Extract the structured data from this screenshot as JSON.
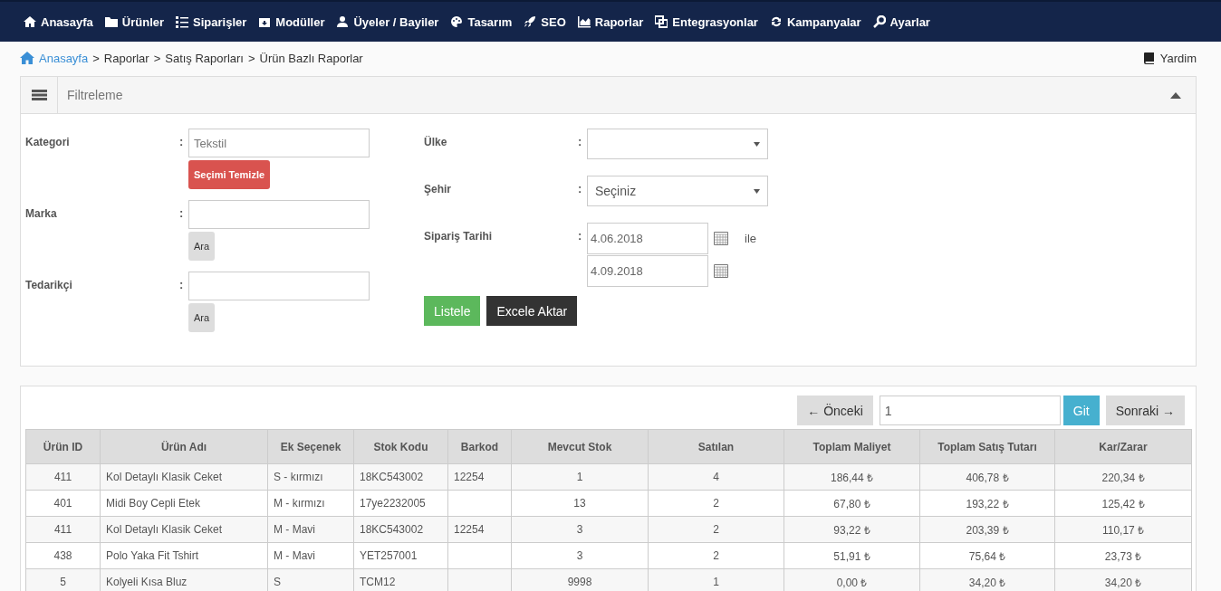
{
  "nav": [
    {
      "label": "Anasayfa"
    },
    {
      "label": "Ürünler"
    },
    {
      "label": "Siparişler"
    },
    {
      "label": "Modüller"
    },
    {
      "label": "Üyeler / Bayiler"
    },
    {
      "label": "Tasarım"
    },
    {
      "label": "SEO"
    },
    {
      "label": "Raporlar"
    },
    {
      "label": "Entegrasyonlar"
    },
    {
      "label": "Kampanyalar"
    },
    {
      "label": "Ayarlar"
    }
  ],
  "breadcrumb": {
    "home": "Anasayfa",
    "items": [
      {
        "separator": ">",
        "label": "Raporlar"
      },
      {
        "separator": ">",
        "label": "Satış Raporları"
      },
      {
        "separator": ">",
        "label": "Ürün Bazlı Raporlar"
      }
    ],
    "help": "Yardim"
  },
  "filter": {
    "title": "Filtreleme",
    "expanded": true,
    "left": [
      {
        "label": "Kategori",
        "colon": ":",
        "kind": "text",
        "value": "Tekstil",
        "button": {
          "label": "Seçimi Temizle",
          "kind": "danger"
        }
      },
      {
        "label": "Marka",
        "colon": ":",
        "kind": "text",
        "button": {
          "label": "Ara",
          "kind": "default"
        }
      },
      {
        "label": "Tedarikçi",
        "colon": ":",
        "kind": "text",
        "button": {
          "label": "Ara",
          "kind": "default"
        }
      }
    ],
    "right": [
      {
        "label": "Ülke",
        "colon": ":",
        "kind": "select"
      },
      {
        "label": "Şehir",
        "colon": ":",
        "kind": "select",
        "value": "Seçiniz"
      },
      {
        "label": "Sipariş Tarihi",
        "colon": ":",
        "kind": "daterange",
        "from": "4.06.2018",
        "between": "ile",
        "to": "4.09.2018"
      }
    ],
    "actions": [
      {
        "label": "Listele",
        "kind": "success"
      },
      {
        "label": "Excele Aktar",
        "kind": "dark"
      }
    ]
  },
  "pager": {
    "previous": "← Önceki",
    "page": "1",
    "go": "Git",
    "next": "Sonraki →"
  },
  "table": {
    "columns": [
      "Ürün ID",
      "Ürün Adı",
      "Ek Seçenek",
      "Stok Kodu",
      "Barkod",
      "Mevcut Stok",
      "Satılan",
      "Toplam Maliyet",
      "Toplam Satış Tutarı",
      "Kar/Zarar"
    ],
    "rows": [
      [
        "411",
        "Kol Detaylı Klasik Ceket",
        "S - kırmızı",
        "18KC543002",
        "12254",
        "1",
        "4",
        "186,44 ₺",
        "406,78 ₺",
        "220,34 ₺"
      ],
      [
        "401",
        "Midi Boy Cepli Etek",
        "M - kırmızı",
        "17ye2232005",
        null,
        "13",
        "2",
        "67,80 ₺",
        "193,22 ₺",
        "125,42 ₺"
      ],
      [
        "411",
        "Kol Detaylı Klasik Ceket",
        "M - Mavi",
        "18KC543002",
        "12254",
        "3",
        "2",
        "93,22 ₺",
        "203,39 ₺",
        "110,17 ₺"
      ],
      [
        "438",
        "Polo Yaka Fit Tshirt",
        "M - Mavi",
        "YET257001",
        null,
        "3",
        "2",
        "51,91 ₺",
        "75,64 ₺",
        "23,73 ₺"
      ],
      [
        "5",
        "Kolyeli Kısa Bluz",
        "S",
        "TCM12",
        null,
        "9998",
        "1",
        "0,00 ₺",
        "34,20 ₺",
        "34,20 ₺"
      ]
    ]
  }
}
